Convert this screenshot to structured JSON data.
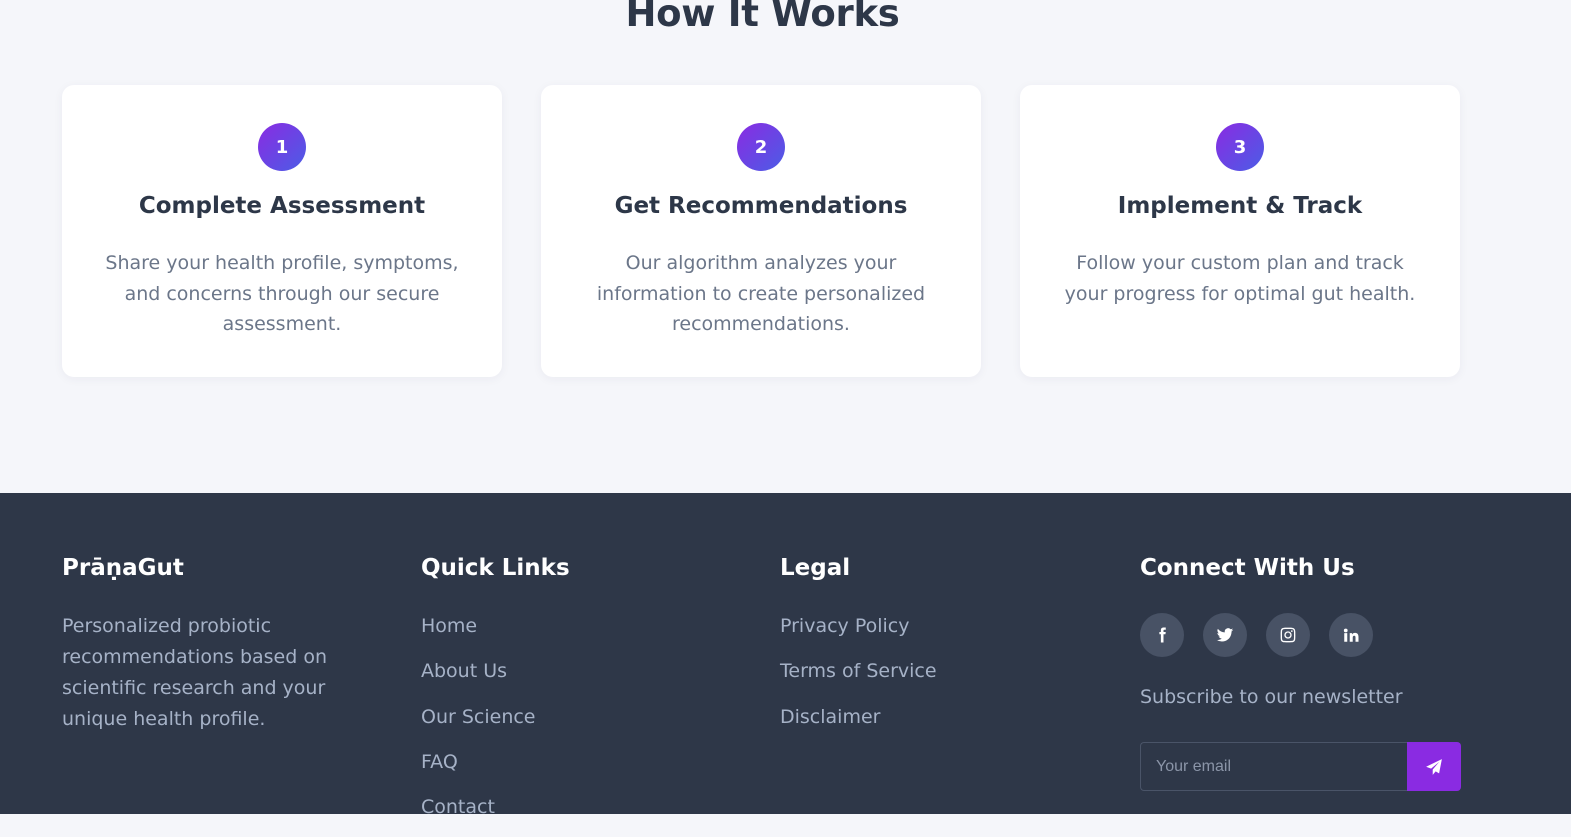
{
  "how_it_works": {
    "title": "How It Works",
    "steps": [
      {
        "number": "1",
        "title": "Complete Assessment",
        "description": "Share your health profile, symptoms, and concerns through our secure assessment."
      },
      {
        "number": "2",
        "title": "Get Recommendations",
        "description": "Our algorithm analyzes your information to create personalized recommendations."
      },
      {
        "number": "3",
        "title": "Implement & Track",
        "description": "Follow your custom plan and track your progress for optimal gut health."
      }
    ]
  },
  "footer": {
    "brand": {
      "name": "PrāṇaGut",
      "description": "Personalized probiotic recommendations based on scientific research and your unique health profile."
    },
    "quick_links": {
      "title": "Quick Links",
      "items": [
        "Home",
        "About Us",
        "Our Science",
        "FAQ",
        "Contact"
      ]
    },
    "legal": {
      "title": "Legal",
      "items": [
        "Privacy Policy",
        "Terms of Service",
        "Disclaimer"
      ]
    },
    "connect": {
      "title": "Connect With Us",
      "social_icons": [
        "facebook-icon",
        "twitter-icon",
        "instagram-icon",
        "linkedin-icon"
      ],
      "newsletter_label": "Subscribe to our newsletter",
      "email_placeholder": "Your email",
      "email_value": "",
      "submit_icon": "paper-plane-icon"
    }
  },
  "colors": {
    "accent": "#8a2be2",
    "gradient_end": "#4b5de6",
    "footer_bg": "#2e3748",
    "heading": "#2d3748",
    "muted_text": "#6b7689",
    "footer_text": "#a6b2c7"
  }
}
